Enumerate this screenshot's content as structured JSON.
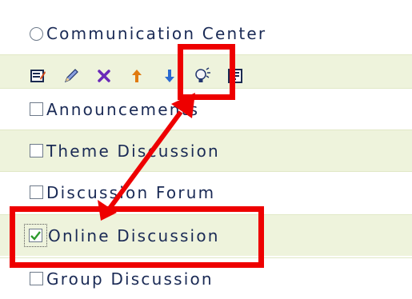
{
  "header": {
    "label": "Communication Center"
  },
  "toolbar": {
    "icons": [
      "edit-properties-icon",
      "pencil-icon",
      "delete-x-icon",
      "move-up-icon",
      "move-down-icon",
      "lightbulb-icon",
      "add-item-icon"
    ]
  },
  "items": [
    {
      "label": "Announcements",
      "checked": false
    },
    {
      "label": "Theme Discussion",
      "checked": false
    },
    {
      "label": "Discussion Forum",
      "checked": false
    },
    {
      "label": "Online Discussion",
      "checked": true
    },
    {
      "label": "Group Discussion",
      "checked": false
    }
  ],
  "colors": {
    "row_green": "#eef3dc",
    "annotation_red": "#ee0000",
    "text": "#1a2a55",
    "check_green": "#2e9a2e"
  }
}
